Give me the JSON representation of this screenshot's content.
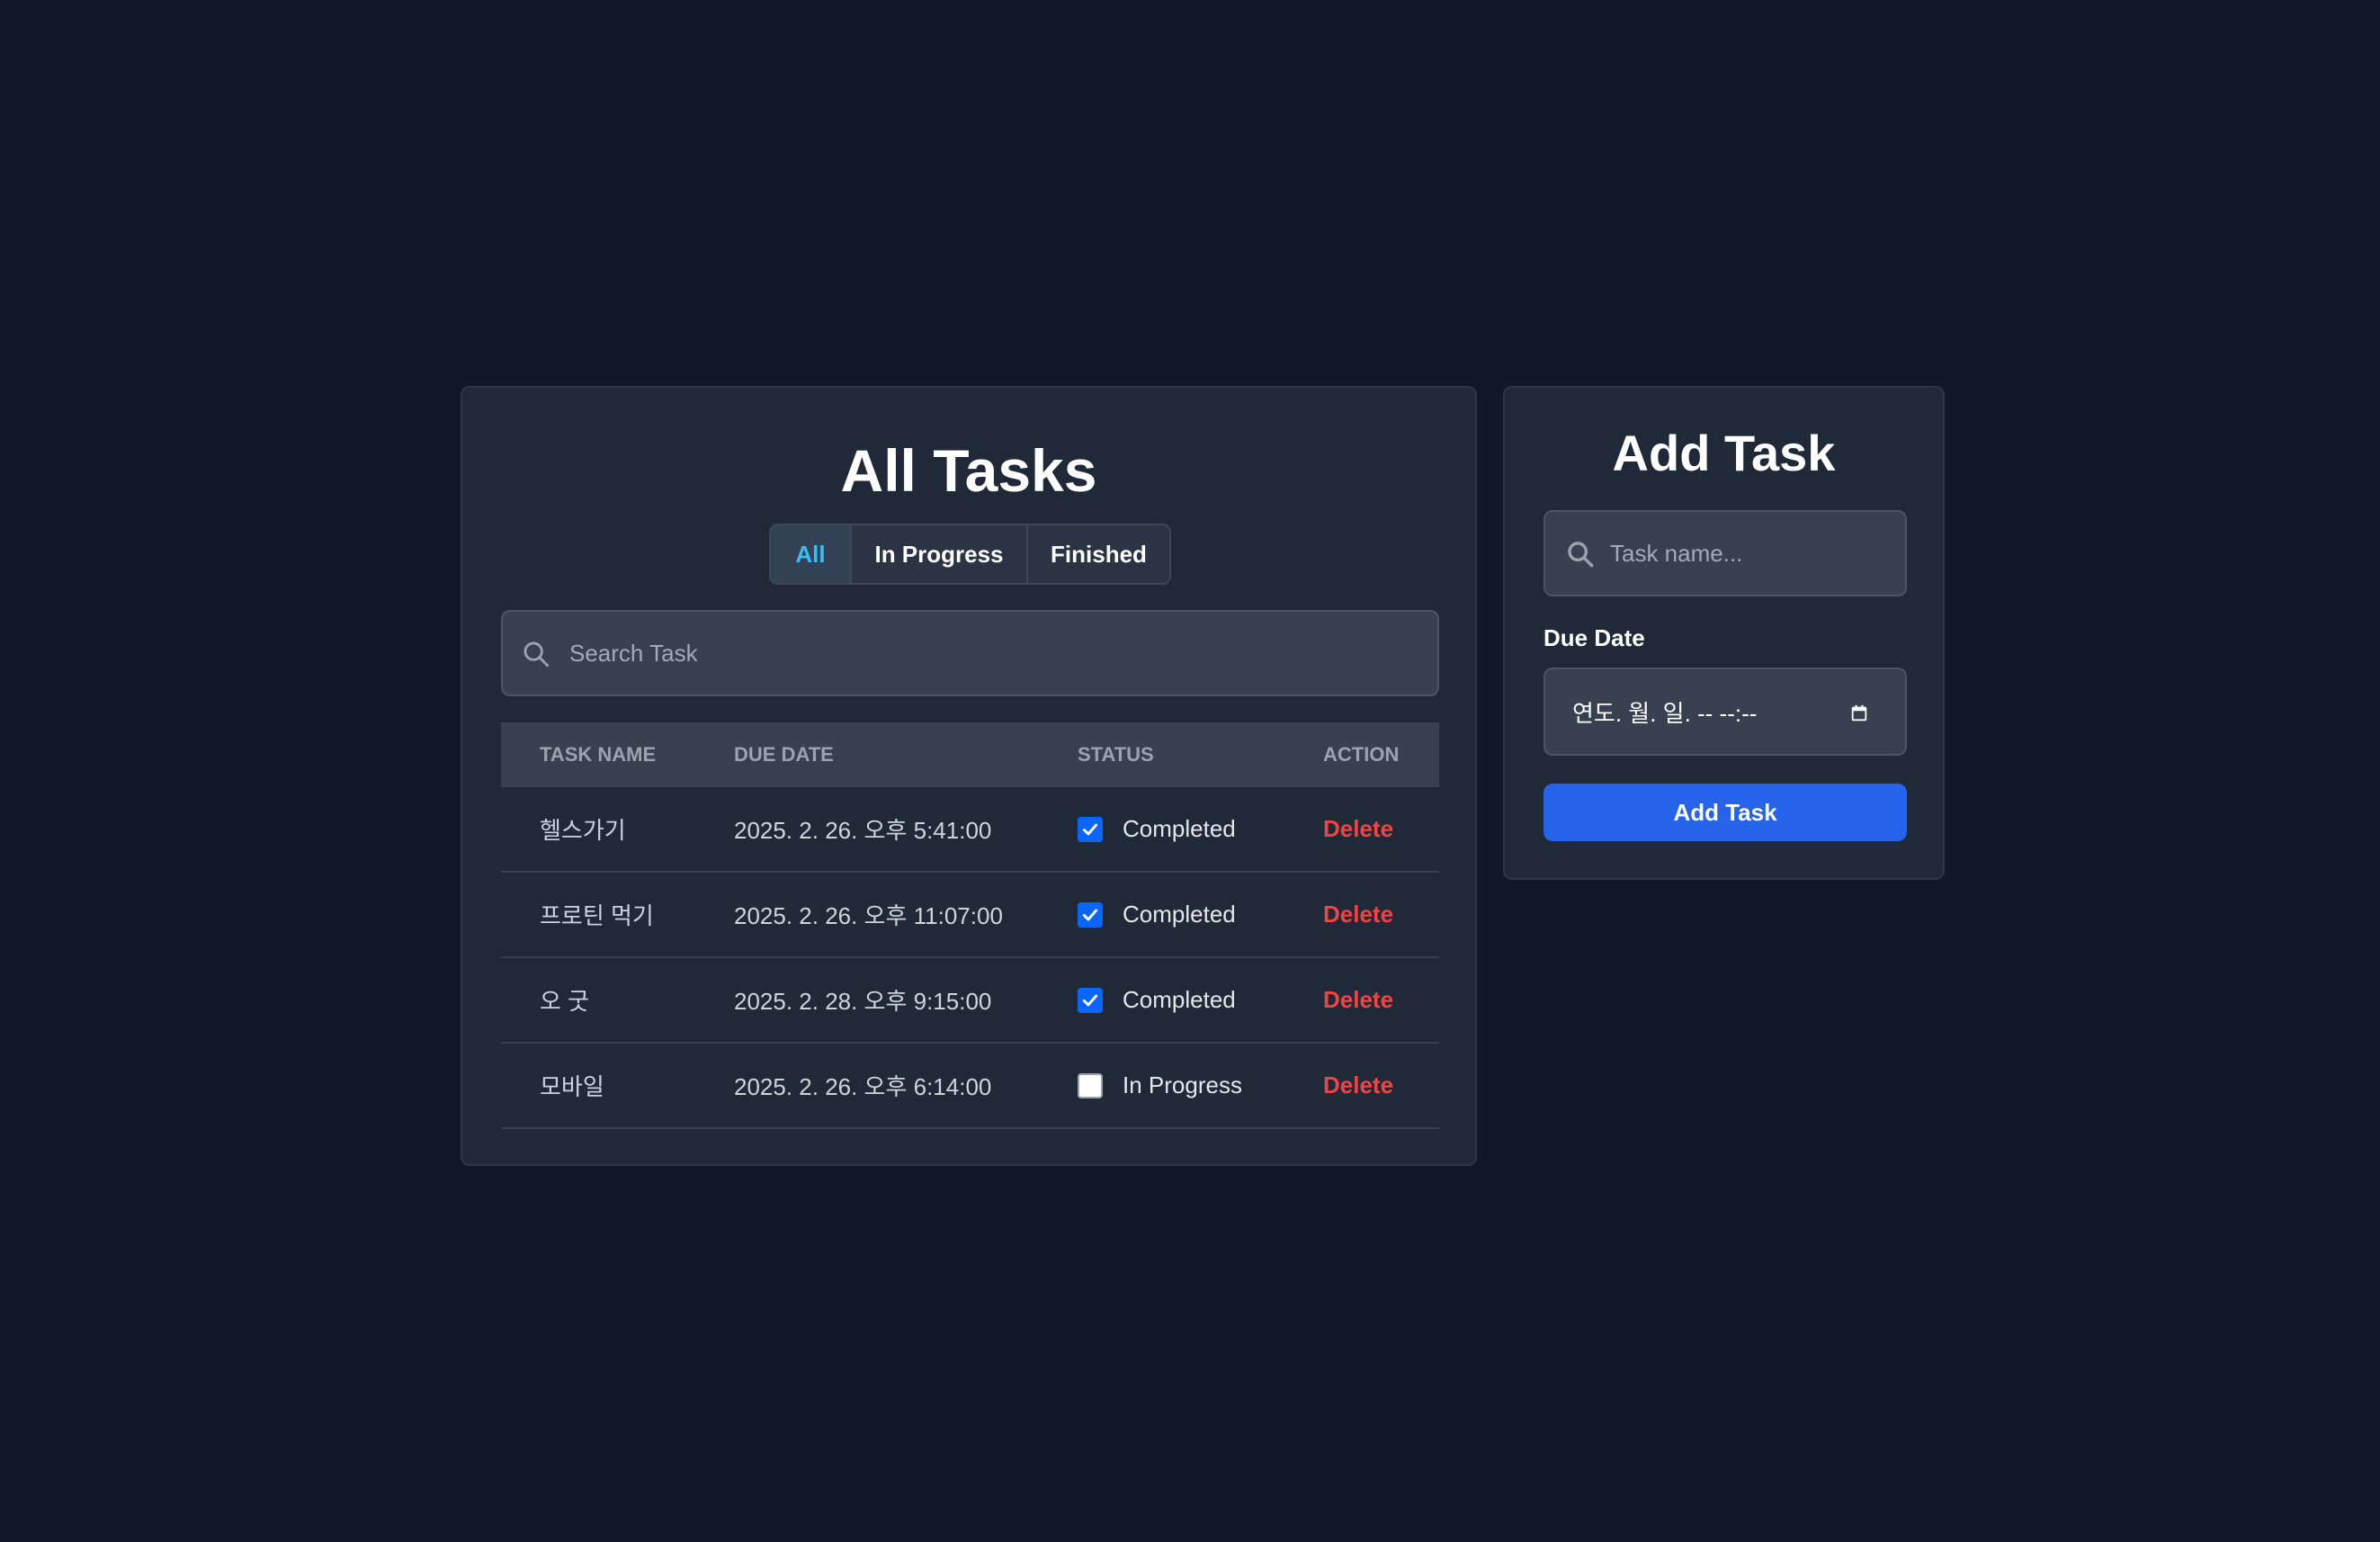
{
  "tasks_panel": {
    "title": "All Tasks",
    "filters": [
      "All",
      "In Progress",
      "Finished"
    ],
    "active_filter": "All",
    "search": {
      "placeholder": "Search Task",
      "value": ""
    },
    "columns": [
      "TASK NAME",
      "DUE DATE",
      "STATUS",
      "ACTION"
    ],
    "rows": [
      {
        "name": "헬스가기",
        "due": "2025. 2. 26. 오후 5:41:00",
        "checked": true,
        "status": "Completed",
        "action": "Delete"
      },
      {
        "name": "프로틴 먹기",
        "due": "2025. 2. 26. 오후 11:07:00",
        "checked": true,
        "status": "Completed",
        "action": "Delete"
      },
      {
        "name": "오 굿",
        "due": "2025. 2. 28. 오후 9:15:00",
        "checked": true,
        "status": "Completed",
        "action": "Delete"
      },
      {
        "name": "모바일",
        "due": "2025. 2. 26. 오후 6:14:00",
        "checked": false,
        "status": "In Progress",
        "action": "Delete"
      }
    ]
  },
  "add_panel": {
    "title": "Add Task",
    "task_name": {
      "placeholder": "Task name...",
      "value": ""
    },
    "due_label": "Due Date",
    "due_value": "연도. 월. 일. -- --:--",
    "button_label": "Add Task"
  },
  "colors": {
    "background": "#111827",
    "panel": "#1f2937",
    "accent": "#38bdf8",
    "primary_button": "#2563eb",
    "delete": "#ef4444",
    "checkbox": "#0b66ff"
  },
  "icons": {
    "search": "search-icon",
    "calendar": "calendar-icon",
    "check": "check-icon"
  }
}
